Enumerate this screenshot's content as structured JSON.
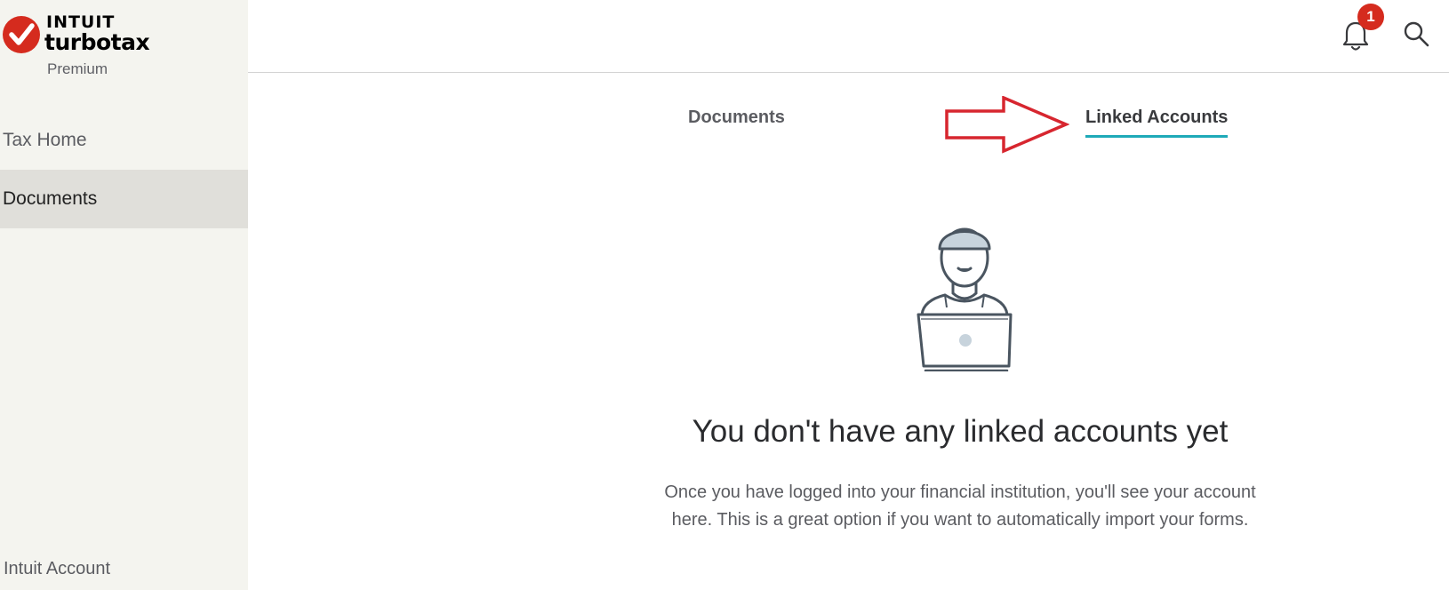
{
  "app": {
    "brand": "INTUIT",
    "product": "turbotax",
    "edition": "Premium"
  },
  "sidebar": {
    "items": [
      {
        "label": "Tax Home",
        "active": false
      },
      {
        "label": "Documents",
        "active": true
      }
    ],
    "footer_link": "Intuit Account"
  },
  "header": {
    "notifications_count": "1",
    "icons": [
      "bell-icon",
      "search-icon"
    ]
  },
  "tabs": [
    {
      "label": "Documents",
      "active": false
    },
    {
      "label": "Linked Accounts",
      "active": true
    }
  ],
  "empty_state": {
    "title": "You don't have any linked accounts yet",
    "line1": "Once you have logged into your financial institution, you'll see your account",
    "line2": "here. This is a great option if you want to automatically import your forms."
  },
  "colors": {
    "sidebar_bg": "#f4f4ef",
    "active_nav_bg": "#e0dfda",
    "tab_underline": "#1eaab8",
    "badge": "#d52b1e",
    "annotation_arrow": "#d7262f"
  }
}
